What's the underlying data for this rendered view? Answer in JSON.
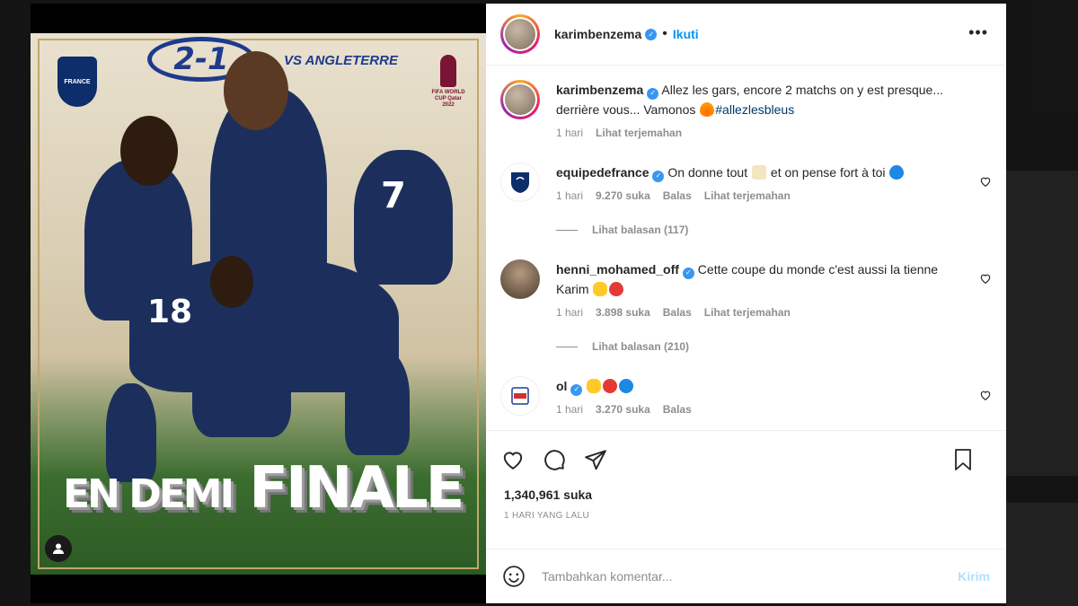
{
  "post": {
    "username": "karimbenzema",
    "follow_label": "Ikuti",
    "more_icon": "more-horizontal-icon",
    "media": {
      "score": "2-1",
      "opponent": "VS ANGLETERRE",
      "crest_text": "FRANCE",
      "worldcup_text": "FIFA WORLD CUP Qatar 2022",
      "headline_small": "EN DEMI",
      "headline_big": "FINALE"
    },
    "caption": {
      "username": "karimbenzema",
      "text": "Allez les gars, encore 2 matchs on y est presque... derrière vous... Vamonos",
      "hashtag": "#allezlesbleus",
      "time": "1 hari",
      "translate": "Lihat terjemahan"
    },
    "comments": [
      {
        "username": "equipedefrance",
        "text_before": "On donne tout",
        "text_after": "et on pense fort à toi",
        "time": "1 hari",
        "likes": "9.270 suka",
        "reply": "Balas",
        "translate": "Lihat terjemahan",
        "view_replies": "Lihat balasan (117)"
      },
      {
        "username": "henni_mohamed_off",
        "text": "Cette coupe du monde c'est aussi la tienne Karim",
        "time": "1 hari",
        "likes": "3.898 suka",
        "reply": "Balas",
        "translate": "Lihat terjemahan",
        "view_replies": "Lihat balasan (210)"
      },
      {
        "username": "ol",
        "time": "1 hari",
        "likes": "3.270 suka",
        "reply": "Balas"
      }
    ],
    "likes_total": "1,340,961 suka",
    "posted_ago": "1 HARI YANG LALU",
    "comment_placeholder": "Tambahkan komentar...",
    "post_button": "Kirim",
    "colors": {
      "accent": "#0095f6",
      "verified": "#3897f0",
      "muted": "#8e8e8e",
      "text": "#262626"
    }
  }
}
